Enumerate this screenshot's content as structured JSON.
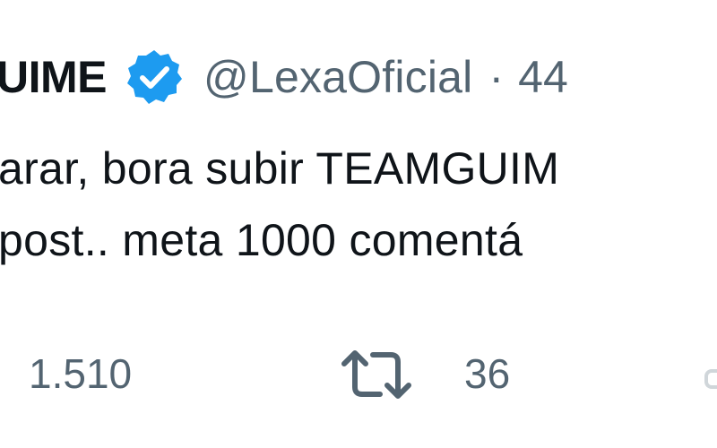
{
  "tweet": {
    "author_name": "UIME",
    "handle": "@LexaOficial",
    "separator": "·",
    "time": "44",
    "lines": [
      "arar, bora subir TEAMGUIM",
      "post.. meta 1000 comentá"
    ]
  },
  "actions": {
    "reply_count": "1.510",
    "retweet_count": "36",
    "retweet_icon": "retweet-icon"
  },
  "colors": {
    "text": "#0f1419",
    "secondary": "#536471",
    "verified": "#1d9bf0",
    "background": "#ffffff"
  },
  "icons": {
    "verified": "verified-badge-icon",
    "retweet": "retweet-icon"
  }
}
